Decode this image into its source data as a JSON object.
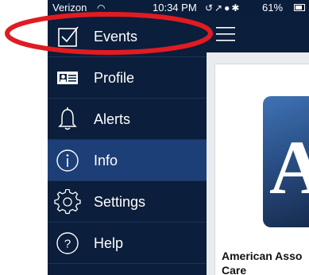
{
  "status_bar": {
    "carrier": "Verizon",
    "time": "10:34 PM",
    "battery": "61%"
  },
  "sidebar": {
    "items": [
      {
        "label": "Events",
        "icon": "checkbox-icon",
        "active": false
      },
      {
        "label": "Profile",
        "icon": "id-card-icon",
        "active": false
      },
      {
        "label": "Alerts",
        "icon": "bell-icon",
        "active": false
      },
      {
        "label": "Info",
        "icon": "info-icon",
        "active": true
      },
      {
        "label": "Settings",
        "icon": "gear-icon",
        "active": false
      },
      {
        "label": "Help",
        "icon": "question-icon",
        "active": false
      }
    ]
  },
  "main": {
    "logo_letter": "A",
    "app_name_line1": "American Asso",
    "app_name_line2": "Care"
  },
  "colors": {
    "sidebar_bg": "#0b1e3b",
    "active_item_bg": "#1d3f78",
    "annotation": "#e11b22"
  }
}
